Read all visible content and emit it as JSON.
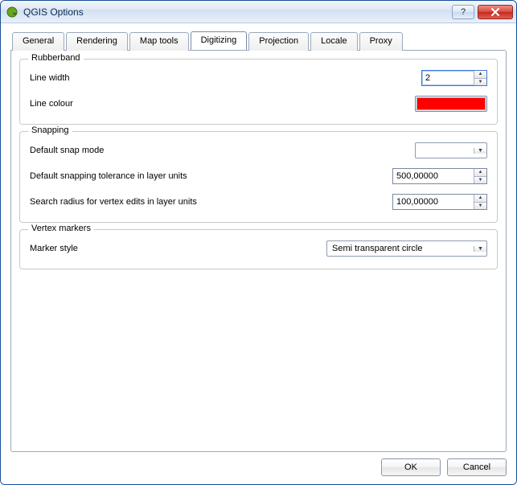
{
  "window": {
    "title": "QGIS Options",
    "icon_name": "qgis-icon"
  },
  "tabs": {
    "items": [
      {
        "label": "General"
      },
      {
        "label": "Rendering"
      },
      {
        "label": "Map tools"
      },
      {
        "label": "Digitizing"
      },
      {
        "label": "Projection"
      },
      {
        "label": "Locale"
      },
      {
        "label": "Proxy"
      }
    ],
    "active_index": 3
  },
  "groups": {
    "rubberband": {
      "title": "Rubberband",
      "line_width_label": "Line width",
      "line_width_value": "2",
      "line_colour_label": "Line colour",
      "line_colour_hex": "#ff0000"
    },
    "snapping": {
      "title": "Snapping",
      "default_snap_mode_label": "Default snap mode",
      "default_snap_mode_value": "",
      "default_tolerance_label": "Default snapping tolerance in layer units",
      "default_tolerance_value": "500,00000",
      "search_radius_label": "Search radius for vertex edits in layer units",
      "search_radius_value": "100,00000"
    },
    "vertex_markers": {
      "title": "Vertex markers",
      "marker_style_label": "Marker style",
      "marker_style_value": "Semi transparent circle"
    }
  },
  "buttons": {
    "ok": "OK",
    "cancel": "Cancel"
  }
}
